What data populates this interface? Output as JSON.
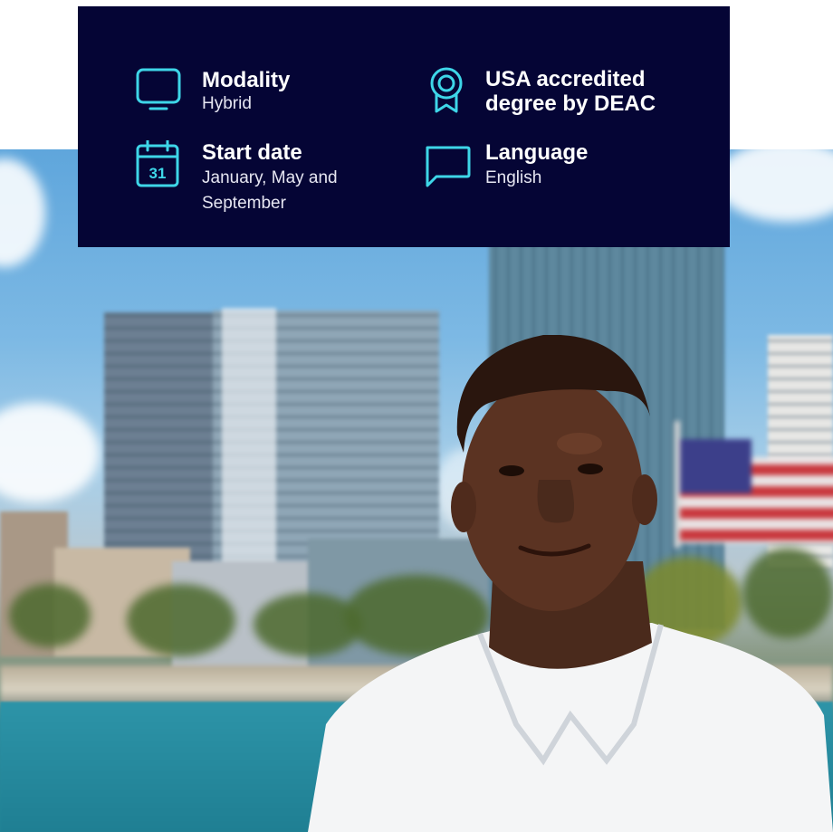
{
  "info_card": {
    "features": [
      {
        "id": "modality",
        "icon": "monitor-icon",
        "title": "Modality",
        "value": "Hybrid"
      },
      {
        "id": "accreditation",
        "icon": "award-ribbon-icon",
        "title_line1": "USA accredited",
        "title_line2": "degree by DEAC"
      },
      {
        "id": "start-date",
        "icon": "calendar-icon",
        "calendar_day": "31",
        "title": "Start date",
        "value_line1": "January, May and",
        "value_line2": "September"
      },
      {
        "id": "language",
        "icon": "speech-bubble-icon",
        "title": "Language",
        "value": "English"
      }
    ],
    "colors": {
      "background": "#050535",
      "icon": "#3ed6e8",
      "text": "#ffffff"
    }
  },
  "hero_image": {
    "subject": "student-portrait",
    "icon": "photo"
  }
}
